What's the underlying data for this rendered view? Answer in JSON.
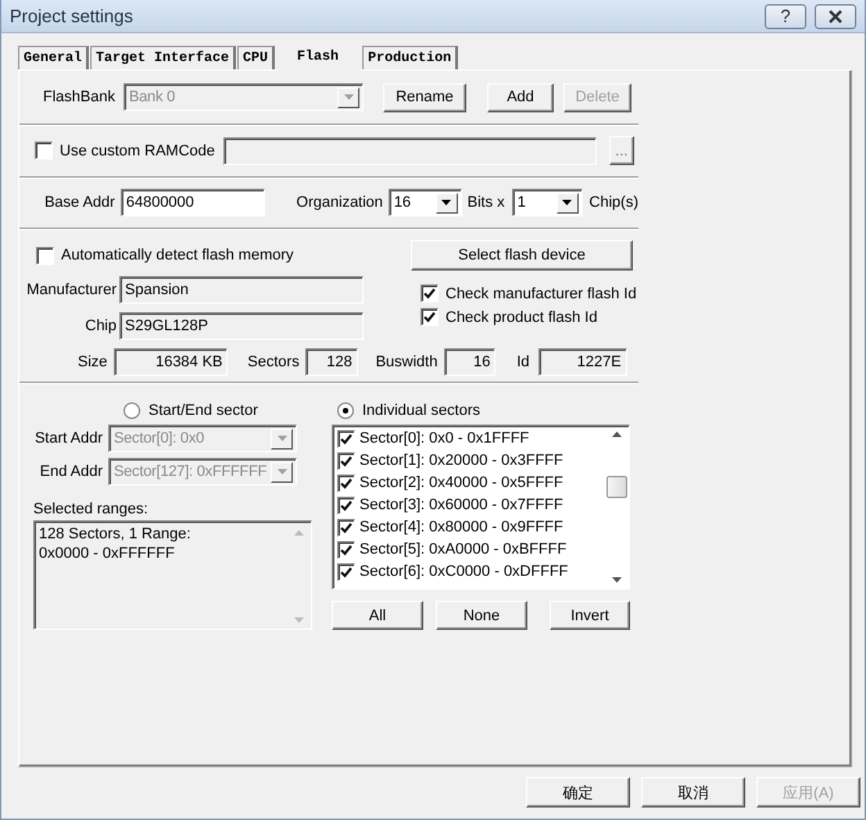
{
  "window": {
    "title": "Project settings",
    "help": "?"
  },
  "tabs": [
    {
      "label": "General",
      "selected": false
    },
    {
      "label": "Target Interface",
      "selected": false
    },
    {
      "label": "CPU",
      "selected": false
    },
    {
      "label": "Flash",
      "selected": true
    },
    {
      "label": "Production",
      "selected": false
    }
  ],
  "flash_bank": {
    "label": "FlashBank",
    "value": "Bank 0",
    "disabled": true
  },
  "bank_buttons": [
    {
      "label": "Rename",
      "disabled": false
    },
    {
      "label": "Add",
      "disabled": false
    },
    {
      "label": "Delete",
      "disabled": true
    }
  ],
  "ram_code": {
    "label": "Use custom RAMCode",
    "checked": false,
    "browse": "..."
  },
  "base_addr": {
    "label": "Base Addr",
    "value": "64800000"
  },
  "organization": {
    "label": "Organization",
    "bits": "16",
    "bits_label": "Bits x",
    "chips": "1",
    "chips_label": "Chip(s)"
  },
  "auto_detect": {
    "label": "Automatically detect flash memory",
    "checked": false
  },
  "select_device_button": "Select flash device",
  "manufacturer": {
    "label": "Manufacturer",
    "value": "Spansion"
  },
  "chip": {
    "label": "Chip",
    "value": "S29GL128P"
  },
  "id_checks": [
    {
      "label": "Check manufacturer flash Id",
      "checked": true
    },
    {
      "label": "Check product flash Id",
      "checked": true
    }
  ],
  "info": [
    {
      "label": "Size",
      "value": "16384 KB"
    },
    {
      "label": "Sectors",
      "value": "128"
    },
    {
      "label": "Buswidth",
      "value": "16"
    },
    {
      "label": "Id",
      "value": "1227E"
    }
  ],
  "sector_mode": [
    {
      "label": "Start/End sector",
      "selected": false
    },
    {
      "label": "Individual sectors",
      "selected": true
    }
  ],
  "start_addr": {
    "label": "Start Addr",
    "value": "Sector[0]: 0x0",
    "disabled": true
  },
  "end_addr": {
    "label": "End Addr",
    "value": "Sector[127]: 0xFFFFFF",
    "disabled": true
  },
  "selected_ranges": {
    "label": "Selected ranges:",
    "lines": [
      "128 Sectors, 1 Range:",
      "0x0000 - 0xFFFFFF"
    ]
  },
  "sectors": [
    {
      "label": "Sector[0]: 0x0 - 0x1FFFF",
      "checked": true
    },
    {
      "label": "Sector[1]: 0x20000 - 0x3FFFF",
      "checked": true
    },
    {
      "label": "Sector[2]: 0x40000 - 0x5FFFF",
      "checked": true
    },
    {
      "label": "Sector[3]: 0x60000 - 0x7FFFF",
      "checked": true
    },
    {
      "label": "Sector[4]: 0x80000 - 0x9FFFF",
      "checked": true
    },
    {
      "label": "Sector[5]: 0xA0000 - 0xBFFFF",
      "checked": true
    },
    {
      "label": "Sector[6]: 0xC0000 - 0xDFFFF",
      "checked": true
    }
  ],
  "sector_buttons": [
    {
      "label": "All"
    },
    {
      "label": "None"
    },
    {
      "label": "Invert"
    }
  ],
  "dialog_buttons": [
    {
      "label": "确定",
      "disabled": false
    },
    {
      "label": "取消",
      "disabled": false
    },
    {
      "label": "应用(A)",
      "disabled": true
    }
  ]
}
